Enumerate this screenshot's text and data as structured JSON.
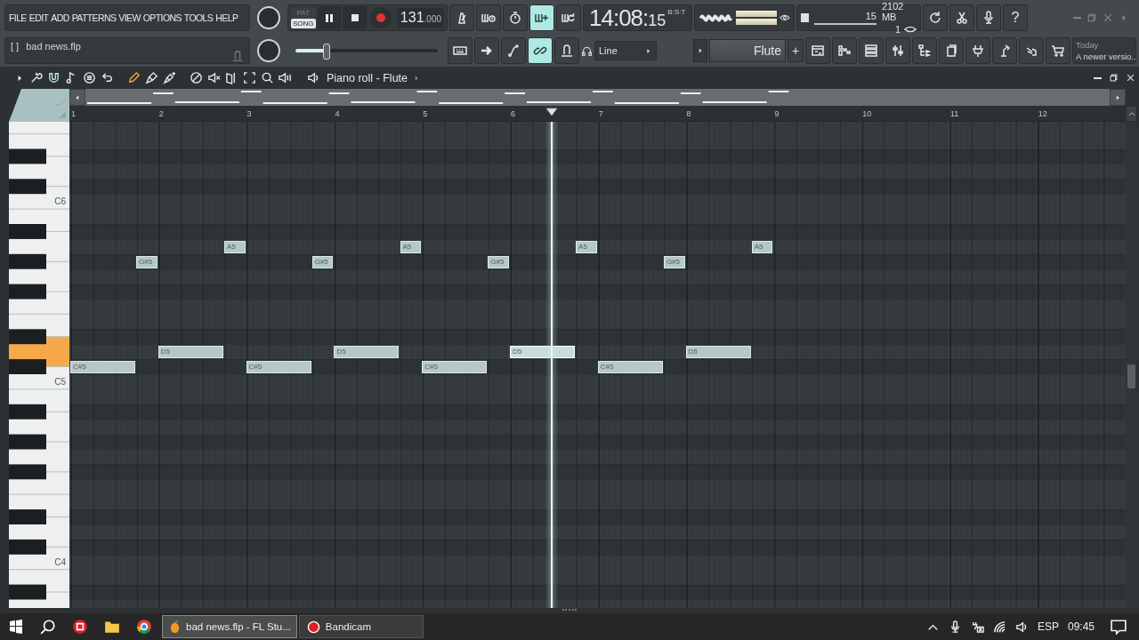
{
  "menu": [
    "FILE",
    "EDIT",
    "ADD",
    "PATTERNS",
    "VIEW",
    "OPTIONS",
    "TOOLS",
    "HELP"
  ],
  "project": {
    "marker": "[  ]",
    "name": "bad news.flp"
  },
  "transport": {
    "modes": [
      {
        "label": "PAT",
        "selected": false
      },
      {
        "label": "SONG",
        "selected": true
      }
    ],
    "tempo": "131",
    "tempo_fraction": ".000"
  },
  "master_slider": {
    "level": 0.22
  },
  "clock": {
    "time": "14:08:",
    "seconds": "15",
    "format": "B:S:T"
  },
  "cpu": {
    "value": "15",
    "memory": "2102 MB",
    "polyphony": "1"
  },
  "toolbar_top": [
    {
      "kind": "metronome",
      "selected": false
    },
    {
      "kind": "wait",
      "selected": false
    },
    {
      "kind": "countdown",
      "selected": false
    },
    {
      "kind": "step",
      "selected": true
    },
    {
      "kind": "loop",
      "selected": false
    }
  ],
  "tools_right": [
    {
      "kind": "refresh",
      "selected": false
    },
    {
      "kind": "scissors",
      "selected": false
    },
    {
      "kind": "mic",
      "selected": false
    }
  ],
  "help": "?",
  "toolbar_bottom": [
    {
      "kind": "typing",
      "selected": false
    },
    {
      "kind": "arrow",
      "selected": false
    },
    {
      "kind": "curve",
      "selected": false
    },
    {
      "kind": "link",
      "selected": true
    },
    {
      "kind": "knob",
      "selected": false
    }
  ],
  "snap": {
    "value": "Line"
  },
  "channel": {
    "value": "Flute",
    "add": "+"
  },
  "windows_bar": [
    {
      "kind": "playlist",
      "selected": false
    },
    {
      "kind": "steps",
      "selected": false
    },
    {
      "kind": "list",
      "selected": false
    },
    {
      "kind": "sliders",
      "selected": false
    },
    {
      "kind": "tree",
      "selected": false
    },
    {
      "kind": "pages",
      "selected": false
    },
    {
      "kind": "plug",
      "selected": false
    },
    {
      "kind": "lamp",
      "selected": false
    },
    {
      "kind": "hand",
      "selected": false
    },
    {
      "kind": "cart",
      "selected": false
    }
  ],
  "news": {
    "date": "Today",
    "text": "A newer versio.."
  },
  "piano_roll": {
    "title": "Piano roll - Flute",
    "tools": [
      {
        "kind": "wrench",
        "active": false
      },
      {
        "kind": "magnet",
        "active": true
      },
      {
        "kind": "note",
        "active": false
      },
      {
        "kind": "circle",
        "active": false
      },
      {
        "kind": "undo",
        "active": false
      },
      {
        "kind": "pencil",
        "active": true
      },
      {
        "kind": "brush",
        "active": false
      },
      {
        "kind": "brushplus",
        "active": false
      },
      {
        "kind": "prohibit",
        "active": false
      },
      {
        "kind": "mute",
        "active": false
      },
      {
        "kind": "slice",
        "active": false
      },
      {
        "kind": "select",
        "active": false
      },
      {
        "kind": "zoom",
        "active": false
      },
      {
        "kind": "playback",
        "active": false
      }
    ],
    "ruler": [
      "1",
      "2",
      "3",
      "4",
      "5",
      "6",
      "7",
      "8",
      "9",
      "10",
      "11",
      "12"
    ],
    "key_labels": [
      "C6",
      "C5",
      "C4"
    ],
    "notes": [
      {
        "label": "C#5",
        "playing": false
      },
      {
        "label": "G#5",
        "playing": false
      },
      {
        "label": "D5",
        "playing": false
      },
      {
        "label": "A5",
        "playing": false
      },
      {
        "label": "C#5",
        "playing": false
      },
      {
        "label": "G#5",
        "playing": false
      },
      {
        "label": "D5",
        "playing": false
      },
      {
        "label": "A5",
        "playing": false
      },
      {
        "label": "C#5",
        "playing": false
      },
      {
        "label": "G#5",
        "playing": false
      },
      {
        "label": "D5",
        "playing": true
      },
      {
        "label": "A5",
        "playing": false
      },
      {
        "label": "C#5",
        "playing": false
      },
      {
        "label": "G#5",
        "playing": false
      },
      {
        "label": "D5",
        "playing": false
      },
      {
        "label": "A5",
        "playing": false
      }
    ]
  },
  "taskbar": {
    "apps": [
      {
        "label": "bad news.flp - FL Stu...",
        "selected": true
      },
      {
        "label": "Bandicam",
        "selected": false
      }
    ],
    "language": "ESP",
    "time": "09:45"
  }
}
